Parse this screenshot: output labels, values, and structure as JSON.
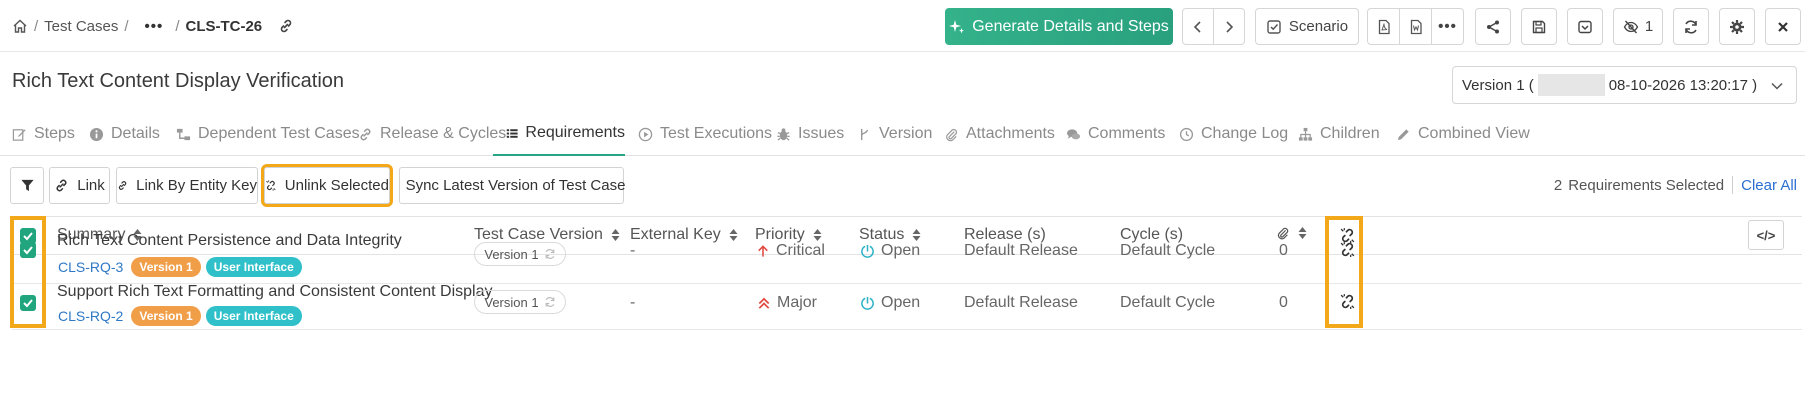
{
  "breadcrumb": {
    "root": "Test Cases",
    "more": "•••",
    "current": "CLS-TC-26"
  },
  "header": {
    "generate_label": "Generate Details and Steps",
    "scenario_label": "Scenario",
    "watch_count": "1"
  },
  "title": "Rich Text Content Display Verification",
  "version_select": {
    "prefix": "Version 1 (",
    "suffix": "08-10-2026 13:20:17 )"
  },
  "tabs": [
    {
      "label": "Steps",
      "icon": "edit-icon"
    },
    {
      "label": "Details",
      "icon": "info-icon"
    },
    {
      "label": "Dependent Test Cases",
      "icon": "dependency-icon"
    },
    {
      "label": "Release & Cycles",
      "icon": "link-icon"
    },
    {
      "label": "Requirements",
      "icon": "list-icon"
    },
    {
      "label": "Test Executions",
      "icon": "play-icon"
    },
    {
      "label": "Issues",
      "icon": "bug-icon"
    },
    {
      "label": "Version",
      "icon": "branch-icon"
    },
    {
      "label": "Attachments",
      "icon": "paperclip-icon"
    },
    {
      "label": "Comments",
      "icon": "comments-icon"
    },
    {
      "label": "Change Log",
      "icon": "history-icon"
    },
    {
      "label": "Children",
      "icon": "sitemap-icon"
    },
    {
      "label": "Combined View",
      "icon": "pencil-icon"
    }
  ],
  "active_tab": "Requirements",
  "toolbar": {
    "link_label": "Link",
    "link_by_key_label": "Link By Entity Key",
    "unlink_selected_label": "Unlink Selected",
    "sync_label": "Sync Latest Version of Test Case"
  },
  "selection": {
    "count": "2",
    "text": "Requirements Selected",
    "clear_label": "Clear All"
  },
  "table": {
    "headers": {
      "summary": "Summary",
      "test_case_version": "Test Case Version",
      "external_key": "External Key",
      "priority": "Priority",
      "status": "Status",
      "release": "Release (s)",
      "cycle": "Cycle (s)"
    },
    "rows": [
      {
        "summary": "Rich Text Content Persistence and Data Integrity",
        "key": "CLS-RQ-3",
        "version_tag": "Version 1",
        "component_tag": "User Interface",
        "tc_version": "Version",
        "tc_version_num": "1",
        "external_key": "-",
        "priority": "Critical",
        "status": "Open",
        "release": "Default Release",
        "cycle": "Default Cycle",
        "attachments": "0"
      },
      {
        "summary": "Support Rich Text Formatting and Consistent Content Display",
        "key": "CLS-RQ-2",
        "version_tag": "Version 1",
        "component_tag": "User Interface",
        "tc_version": "Version",
        "tc_version_num": "1",
        "external_key": "-",
        "priority": "Major",
        "status": "Open",
        "release": "Default Release",
        "cycle": "Default Cycle",
        "attachments": "0"
      }
    ]
  },
  "colors": {
    "accent": "#27a586",
    "highlight": "#f2a818",
    "link": "#2f78c5",
    "priority": "#e0483e",
    "status": "#2bb2c6"
  }
}
